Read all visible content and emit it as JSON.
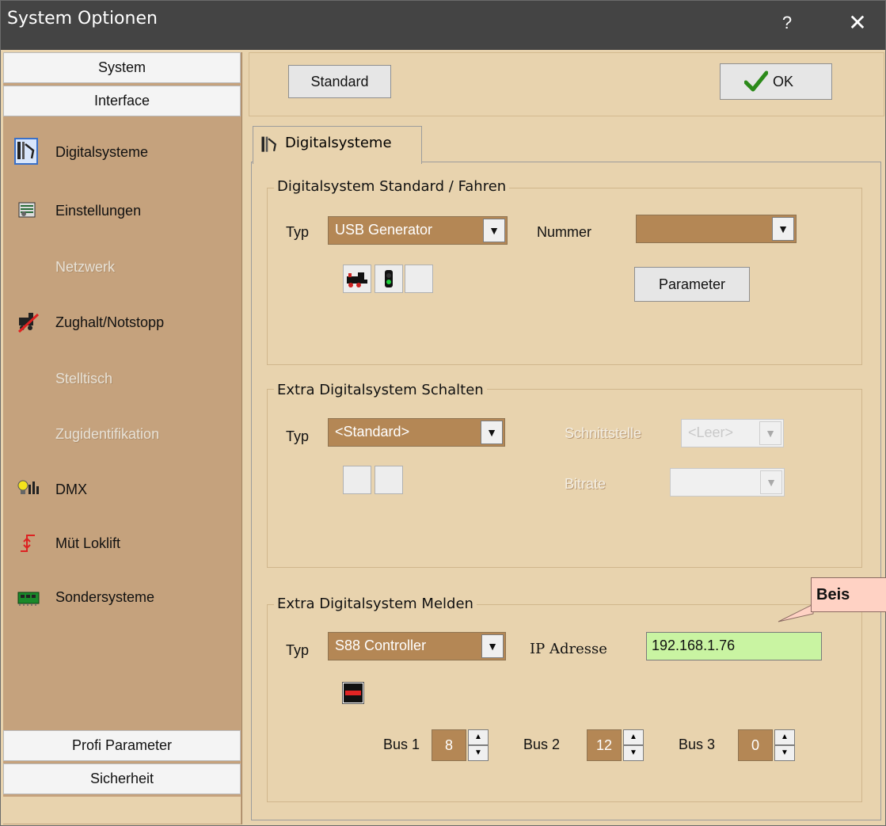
{
  "window": {
    "title": "System Optionen",
    "help_symbol": "?",
    "close_symbol": "✕"
  },
  "sidebar": {
    "top_buttons": [
      "System",
      "Interface"
    ],
    "items": [
      {
        "label": "Digitalsysteme",
        "icon": "digital-system-icon",
        "enabled": true,
        "active": true
      },
      {
        "label": "Einstellungen",
        "icon": "settings-icon",
        "enabled": true,
        "active": false
      },
      {
        "label": "Netzwerk",
        "icon": "",
        "enabled": false,
        "active": false
      },
      {
        "label": "Zughalt/Notstopp",
        "icon": "emergency-stop-icon",
        "enabled": true,
        "active": false
      },
      {
        "label": "Stelltisch",
        "icon": "",
        "enabled": false,
        "active": false
      },
      {
        "label": "Zugidentifikation",
        "icon": "",
        "enabled": false,
        "active": false
      },
      {
        "label": "DMX",
        "icon": "dmx-icon",
        "enabled": true,
        "active": false
      },
      {
        "label": "Müt Loklift",
        "icon": "loklift-icon",
        "enabled": true,
        "active": false
      },
      {
        "label": "Sondersysteme",
        "icon": "special-systems-icon",
        "enabled": true,
        "active": false
      }
    ],
    "bottom_buttons": [
      "Profi Parameter",
      "Sicherheit"
    ]
  },
  "toolbar": {
    "standard_label": "Standard",
    "ok_label": "OK"
  },
  "tab": {
    "label": "Digitalsysteme"
  },
  "group1": {
    "title": "Digitalsystem Standard / Fahren",
    "typ_label": "Typ",
    "typ_value": "USB Generator",
    "nummer_label": "Nummer",
    "nummer_value": "",
    "parameter_label": "Parameter"
  },
  "group2": {
    "title": "Extra Digitalsystem Schalten",
    "typ_label": "Typ",
    "typ_value": "<Standard>",
    "schnittstelle_label": "Schnittstelle",
    "schnittstelle_value": "<Leer>",
    "bitrate_label": "Bitrate",
    "bitrate_value": ""
  },
  "group3": {
    "title": "Extra Digitalsystem Melden",
    "typ_label": "Typ",
    "typ_value": "S88 Controller",
    "ip_label": "IP Adresse",
    "ip_value": "192.168.1.76",
    "bus1_label": "Bus 1",
    "bus1_value": "8",
    "bus2_label": "Bus 2",
    "bus2_value": "12",
    "bus3_label": "Bus 3",
    "bus3_value": "0"
  },
  "tooltip": {
    "text": "Beis"
  },
  "colors": {
    "titlebar": "#444444",
    "panel": "#e8d3ae",
    "sidebar": "#c5a27d",
    "combo": "#b48755",
    "ip_field": "#c9f4a2"
  }
}
